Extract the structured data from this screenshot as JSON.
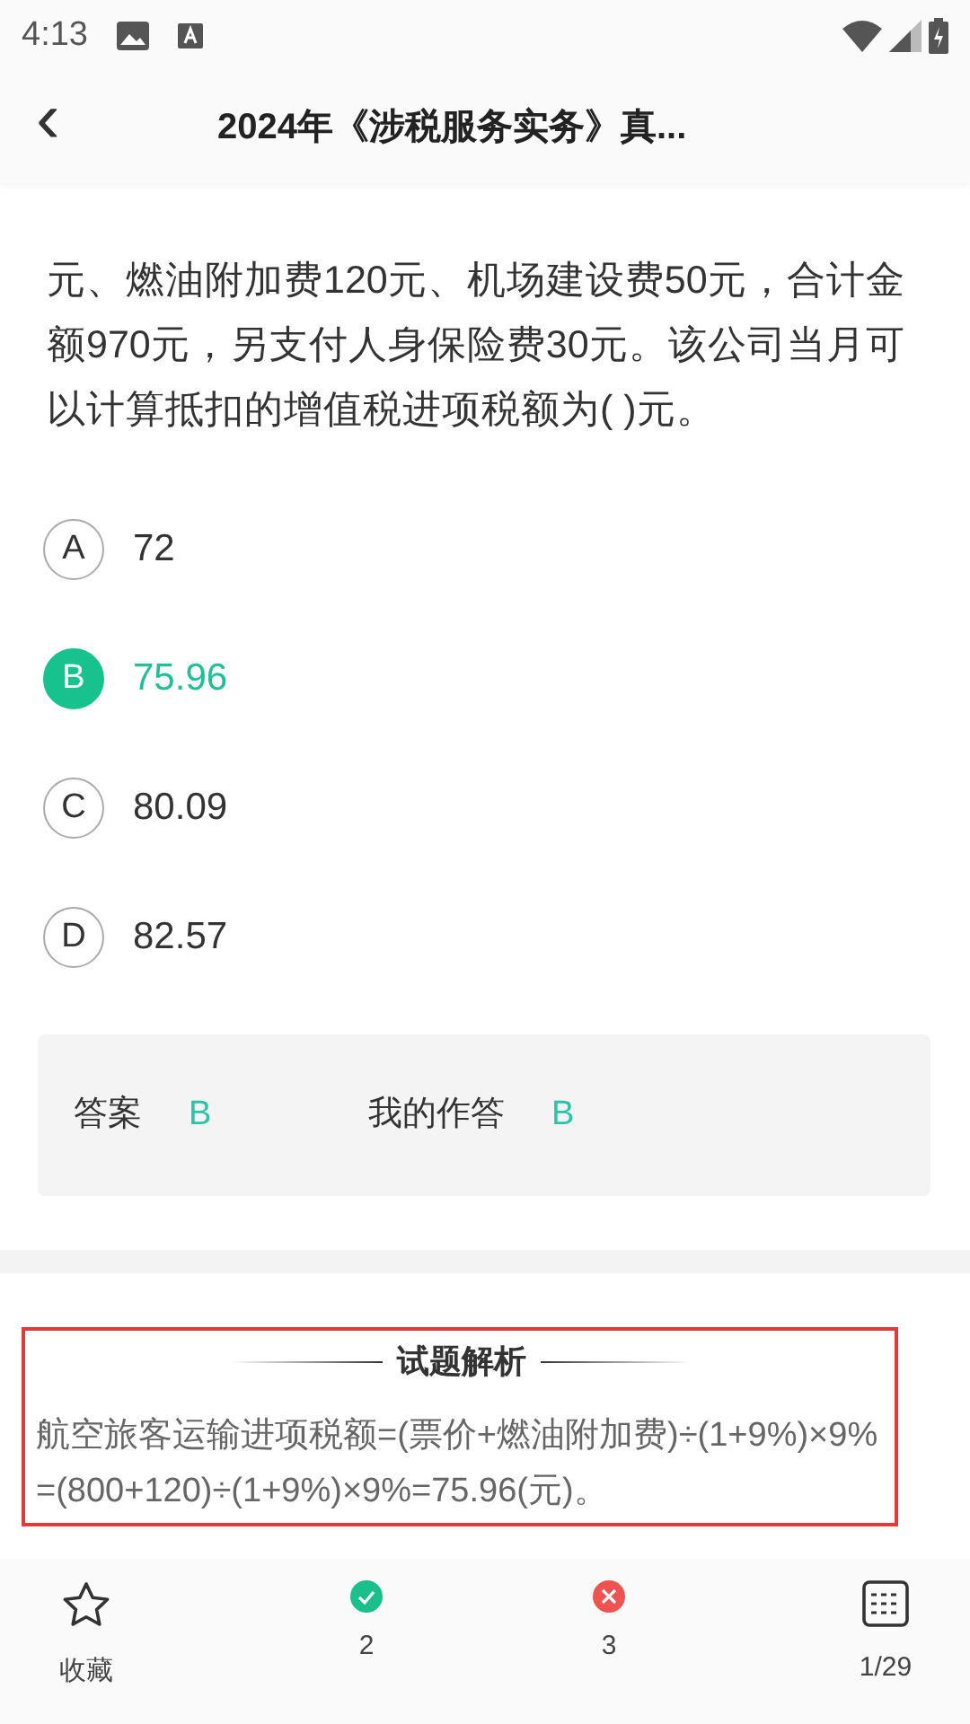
{
  "status_bar": {
    "time": "4:13"
  },
  "header": {
    "back": "‹",
    "title": "2024年《涉税服务实务》真..."
  },
  "question": {
    "text": "元、燃油附加费120元、机场建设费50元，合计金额970元，另支付人身保险费30元。该公司当月可以计算抵扣的增值税进项税额为( )元。"
  },
  "options": [
    {
      "letter": "A",
      "text": "72",
      "selected": false
    },
    {
      "letter": "B",
      "text": "75.96",
      "selected": true
    },
    {
      "letter": "C",
      "text": "80.09",
      "selected": false
    },
    {
      "letter": "D",
      "text": "82.57",
      "selected": false
    }
  ],
  "answer_box": [
    {
      "label": "答案",
      "value": "B"
    },
    {
      "label": "我的作答",
      "value": "B"
    }
  ],
  "explanation": {
    "title": "试题解析",
    "text": "航空旅客运输进项税额=(票价+燃油附加费)÷(1+9%)×9%=(800+120)÷(1+9%)×9%=75.96(元)。"
  },
  "bottom_nav": [
    {
      "kind": "favorite",
      "label": "收藏"
    },
    {
      "kind": "correct",
      "label": "2"
    },
    {
      "kind": "wrong",
      "label": "3"
    },
    {
      "kind": "sheet",
      "label": "1/29"
    }
  ]
}
